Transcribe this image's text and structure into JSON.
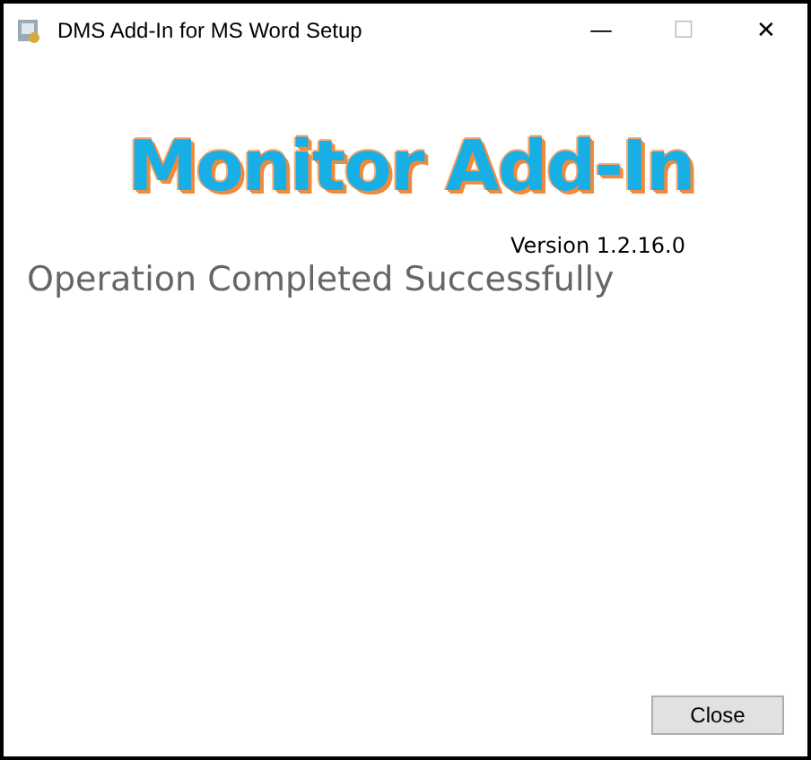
{
  "window": {
    "title": "DMS Add-In for MS Word Setup",
    "controls": [
      "—",
      "☐",
      "✕"
    ]
  },
  "logo": "Monitor Add-In",
  "version": "Version 1.2.16.0",
  "status": "Operation Completed Successfully",
  "buttons": [
    "Close"
  ]
}
